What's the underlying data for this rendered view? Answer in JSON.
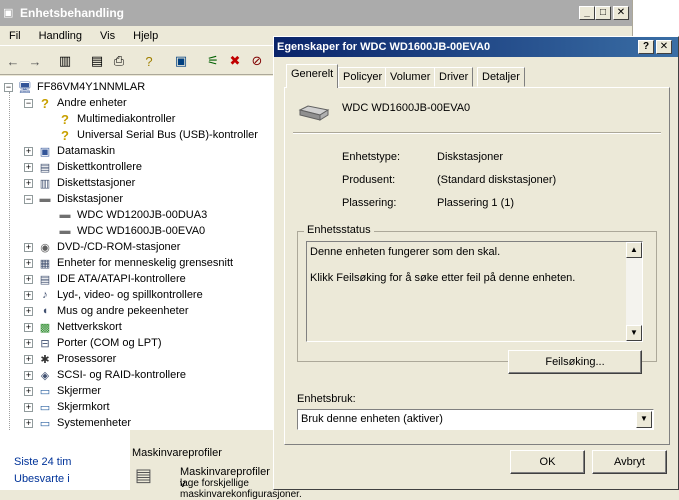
{
  "main": {
    "title": "Enhetsbehandling",
    "menu": [
      "Fil",
      "Handling",
      "Vis",
      "Hjelp"
    ],
    "min": "_",
    "max": "□",
    "close": "✕"
  },
  "tree": [
    {
      "label": "FF86VM4Y1NNMLAR",
      "icon": "computer-icon",
      "glyph": "🖥",
      "pm": "−",
      "level": 0
    },
    {
      "label": "Andre enheter",
      "icon": "unknown-device-icon",
      "glyph": "?",
      "pm": "−",
      "level": 1
    },
    {
      "label": "Multimediakontroller",
      "icon": "warning-icon",
      "glyph": "?",
      "pm": "",
      "level": 2
    },
    {
      "label": "Universal Serial Bus (USB)-kontroller",
      "icon": "warning-icon",
      "glyph": "?",
      "pm": "",
      "level": 2
    },
    {
      "label": "Datamaskin",
      "icon": "computer-icon",
      "glyph": "▣",
      "pm": "+",
      "level": 1
    },
    {
      "label": "Diskettkontrollere",
      "icon": "controller-icon",
      "glyph": "▤",
      "pm": "+",
      "level": 1
    },
    {
      "label": "Diskettstasjoner",
      "icon": "floppy-icon",
      "glyph": "▥",
      "pm": "+",
      "level": 1
    },
    {
      "label": "Diskstasjoner",
      "icon": "disk-icon",
      "glyph": "▬",
      "pm": "−",
      "level": 1
    },
    {
      "label": "WDC WD1200JB-00DUA3",
      "icon": "disk-icon",
      "glyph": "▬",
      "pm": "",
      "level": 2
    },
    {
      "label": "WDC WD1600JB-00EVA0",
      "icon": "disk-icon",
      "glyph": "▬",
      "pm": "",
      "level": 2
    },
    {
      "label": "DVD-/CD-ROM-stasjoner",
      "icon": "cdrom-icon",
      "glyph": "◉",
      "pm": "+",
      "level": 1
    },
    {
      "label": "Enheter for menneskelig grensesnitt",
      "icon": "hid-icon",
      "glyph": "▦",
      "pm": "+",
      "level": 1
    },
    {
      "label": "IDE ATA/ATAPI-kontrollere",
      "icon": "ide-icon",
      "glyph": "▤",
      "pm": "+",
      "level": 1
    },
    {
      "label": "Lyd-, video- og spillkontrollere",
      "icon": "sound-icon",
      "glyph": "♪",
      "pm": "+",
      "level": 1
    },
    {
      "label": "Mus og andre pekeenheter",
      "icon": "mouse-icon",
      "glyph": "◖",
      "pm": "+",
      "level": 1
    },
    {
      "label": "Nettverkskort",
      "icon": "network-icon",
      "glyph": "▩",
      "pm": "+",
      "level": 1
    },
    {
      "label": "Porter (COM og LPT)",
      "icon": "port-icon",
      "glyph": "⊟",
      "pm": "+",
      "level": 1
    },
    {
      "label": "Prosessorer",
      "icon": "cpu-icon",
      "glyph": "✱",
      "pm": "+",
      "level": 1
    },
    {
      "label": "SCSI- og RAID-kontrollere",
      "icon": "scsi-icon",
      "glyph": "◈",
      "pm": "+",
      "level": 1
    },
    {
      "label": "Skjermer",
      "icon": "monitor-icon",
      "glyph": "▭",
      "pm": "+",
      "level": 1
    },
    {
      "label": "Skjermkort",
      "icon": "display-adapter-icon",
      "glyph": "▭",
      "pm": "+",
      "level": 1
    },
    {
      "label": "Systemenheter",
      "icon": "system-icon",
      "glyph": "▭",
      "pm": "+",
      "level": 1
    }
  ],
  "behind": {
    "item1": "Siste 24 tim",
    "item2": "Ubesvarte i",
    "header": "Maskinvareprofiler",
    "text1": "Maskinvareprofiler v",
    "text2": "lage forskjellige maskinvarekonfigurasjoner."
  },
  "dialog": {
    "title": "Egenskaper for WDC WD1600JB-00EVA0",
    "help": "?",
    "close": "✕",
    "tabs": [
      "Generelt",
      "Policyer",
      "Volumer",
      "Driver",
      "Detaljer"
    ],
    "device_name": "WDC WD1600JB-00EVA0",
    "type_label": "Enhetstype:",
    "type_value": "Diskstasjoner",
    "mfr_label": "Produsent:",
    "mfr_value": "(Standard diskstasjoner)",
    "loc_label": "Plassering:",
    "loc_value": "Plassering 1 (1)",
    "status_group": "Enhetsstatus",
    "status_line1": "Denne enheten fungerer som den skal.",
    "status_line2": "Klikk Feilsøking for å søke etter feil på denne enheten.",
    "troubleshoot": "Feilsøking...",
    "usage_label": "Enhetsbruk:",
    "usage_value": "Bruk denne enheten (aktiver)",
    "ok": "OK",
    "cancel": "Avbryt"
  }
}
